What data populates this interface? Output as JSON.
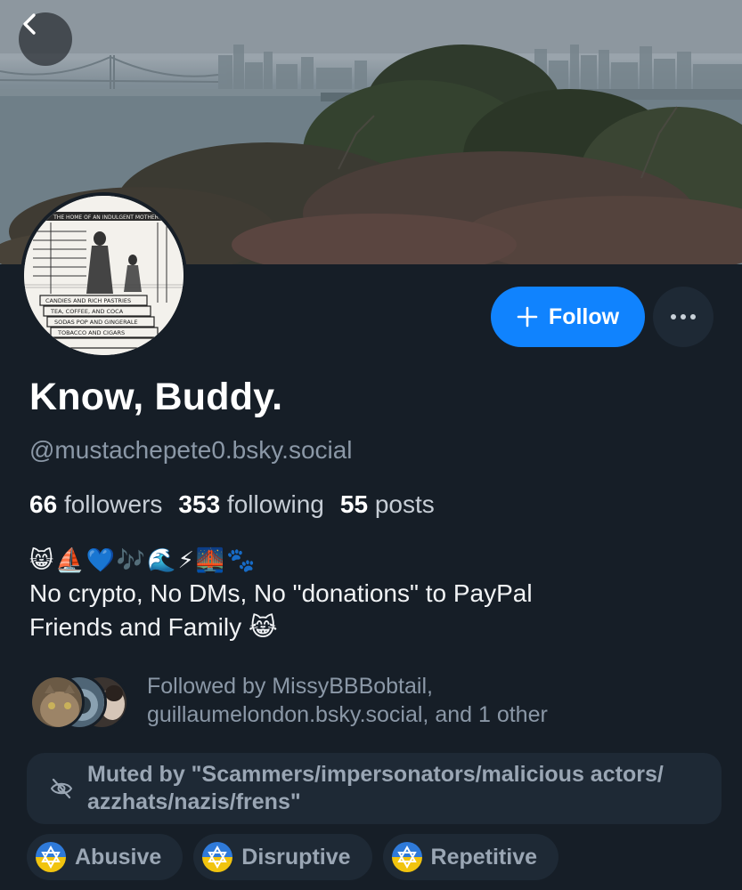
{
  "profile": {
    "display_name": "Know, Buddy.",
    "handle": "@mustachepete0.bsky.social",
    "stats": {
      "followers_count": "66",
      "followers_label": "followers",
      "following_count": "353",
      "following_label": "following",
      "posts_count": "55",
      "posts_label": "posts"
    },
    "bio": {
      "emoji_line": [
        "😸",
        "⛵",
        "💙",
        "🎶",
        "🌊",
        "⚡",
        "🌉",
        "🐾"
      ],
      "line1": "No crypto, No DMs, No \"donations\" to PayPal",
      "line2": "Friends and Family",
      "line2_emoji": "😹"
    },
    "avatar_sign_text": [
      "THE HOME OF AN INDULGENT MOTHER",
      "CANDIES AND RICH PASTRIES",
      "TEA, COFFEE, AND COCA",
      "SODAS POP AND GINGERALE",
      "TOBACCO AND CIGARS"
    ]
  },
  "actions": {
    "follow_label": "Follow",
    "follow_icon": "plus-icon",
    "more_icon": "ellipsis-icon",
    "back_icon": "chevron-left-icon"
  },
  "followed_by": {
    "line1": "Followed by MissyBBBobtail,",
    "line2": "guillaumelondon.bsky.social, and 1 other"
  },
  "muted": {
    "icon": "eye-slash-icon",
    "line1": "Muted by \"Scammers/impersonators/malicious actors/",
    "line2": "azzhats/nazis/frens\""
  },
  "labels": [
    {
      "label": "Abusive",
      "icon": "labeler-avatar-icon"
    },
    {
      "label": "Disruptive",
      "icon": "labeler-avatar-icon"
    },
    {
      "label": "Repetitive",
      "icon": "labeler-avatar-icon"
    }
  ],
  "colors": {
    "background": "#161e27",
    "accent": "#1083fe",
    "muted_text": "#8b98a7",
    "chip_bg": "#1e2935"
  }
}
